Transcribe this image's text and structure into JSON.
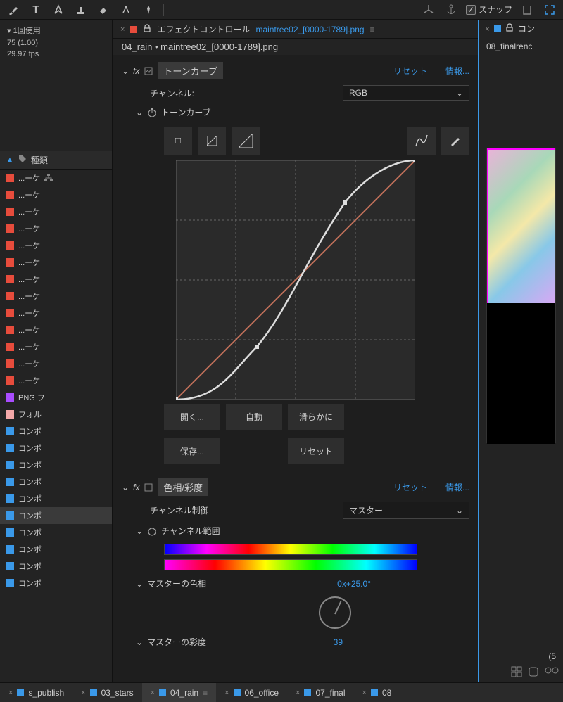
{
  "toolbar": {
    "snap_label": "スナップ"
  },
  "left": {
    "usage": "1回使用",
    "size": "75 (1.00)",
    "fps": "29.97 fps",
    "type_header": "種類",
    "rows": [
      {
        "color": "#e74c3c",
        "label": "...ーケ",
        "tree": true
      },
      {
        "color": "#e74c3c",
        "label": "...ーケ"
      },
      {
        "color": "#e74c3c",
        "label": "...ーケ"
      },
      {
        "color": "#e74c3c",
        "label": "...ーケ"
      },
      {
        "color": "#e74c3c",
        "label": "...ーケ"
      },
      {
        "color": "#e74c3c",
        "label": "...ーケ"
      },
      {
        "color": "#e74c3c",
        "label": "...ーケ"
      },
      {
        "color": "#e74c3c",
        "label": "...ーケ"
      },
      {
        "color": "#e74c3c",
        "label": "...ーケ"
      },
      {
        "color": "#e74c3c",
        "label": "...ーケ"
      },
      {
        "color": "#e74c3c",
        "label": "...ーケ"
      },
      {
        "color": "#e74c3c",
        "label": "...ーケ"
      },
      {
        "color": "#e74c3c",
        "label": "...ーケ"
      },
      {
        "color": "#a94cff",
        "label": "PNG フ"
      },
      {
        "color": "#f4a8a8",
        "label": "フォル"
      },
      {
        "color": "#3a99e9",
        "label": "コンポ"
      },
      {
        "color": "#3a99e9",
        "label": "コンポ"
      },
      {
        "color": "#3a99e9",
        "label": "コンポ"
      },
      {
        "color": "#3a99e9",
        "label": "コンポ"
      },
      {
        "color": "#3a99e9",
        "label": "コンポ"
      },
      {
        "color": "#3a99e9",
        "label": "コンポ",
        "sel": true
      },
      {
        "color": "#3a99e9",
        "label": "コンポ"
      },
      {
        "color": "#3a99e9",
        "label": "コンポ"
      },
      {
        "color": "#3a99e9",
        "label": "コンポ"
      },
      {
        "color": "#3a99e9",
        "label": "コンポ"
      }
    ]
  },
  "panel": {
    "title": "エフェクトコントロール",
    "filename": "maintree02_[0000-1789].png",
    "breadcrumb": "04_rain • maintree02_[0000-1789].png"
  },
  "curves": {
    "name": "トーンカーブ",
    "reset": "リセット",
    "info": "情報...",
    "channel_label": "チャンネル:",
    "channel_value": "RGB",
    "sub_name": "トーンカーブ",
    "open": "開く...",
    "auto": "自動",
    "smooth": "滑らかに",
    "save": "保存...",
    "reset2": "リセット"
  },
  "hue": {
    "name": "色相/彩度",
    "reset": "リセット",
    "info": "情報...",
    "control_label": "チャンネル制御",
    "control_value": "マスター",
    "range_label": "チャンネル範囲",
    "hue_label": "マスターの色相",
    "hue_value": "0x+25.0°",
    "sat_label": "マスターの彩度",
    "sat_value": "39"
  },
  "right": {
    "tab_title": "コン",
    "breadcrumb": "08_finalrenc",
    "status": "(5"
  },
  "bottom": {
    "tabs": [
      {
        "label": "s_publish",
        "color": "#3a99e9"
      },
      {
        "label": "03_stars",
        "color": "#3a99e9"
      },
      {
        "label": "04_rain",
        "color": "#3a99e9",
        "active": true
      },
      {
        "label": "06_office",
        "color": "#3a99e9"
      },
      {
        "label": "07_final",
        "color": "#3a99e9"
      },
      {
        "label": "08",
        "color": "#3a99e9"
      }
    ]
  }
}
